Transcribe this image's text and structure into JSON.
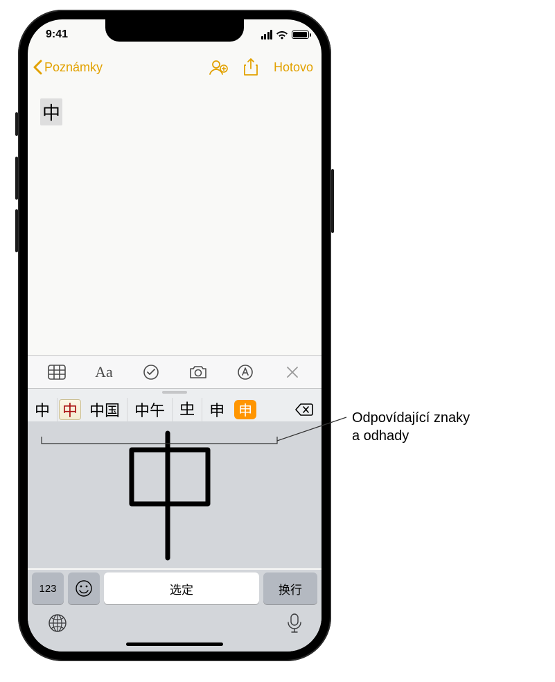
{
  "status": {
    "time": "9:41"
  },
  "nav": {
    "back_label": "Poznámky",
    "done_label": "Hotovo"
  },
  "note": {
    "typed_char": "中"
  },
  "toolbar": {
    "format_label": "Aa"
  },
  "candidates": {
    "items": [
      "中",
      "中",
      "中国",
      "中午",
      "𠀐",
      "申",
      "申"
    ]
  },
  "keyboard": {
    "numbers_label": "123",
    "space_label": "选定",
    "return_label": "换行"
  },
  "callout": {
    "line1": "Odpovídající znaky",
    "line2": "a odhady"
  },
  "icons": {
    "collaborate": "collaborate-icon",
    "share": "share-icon",
    "table": "table-icon",
    "checklist": "checklist-icon",
    "camera": "camera-icon",
    "markup": "markup-icon",
    "close": "close-icon",
    "delete": "delete-icon",
    "emoji": "emoji-icon",
    "globe": "globe-icon",
    "mic": "mic-icon",
    "wifi": "wifi-icon",
    "chevron_back": "chevron-left-icon"
  }
}
